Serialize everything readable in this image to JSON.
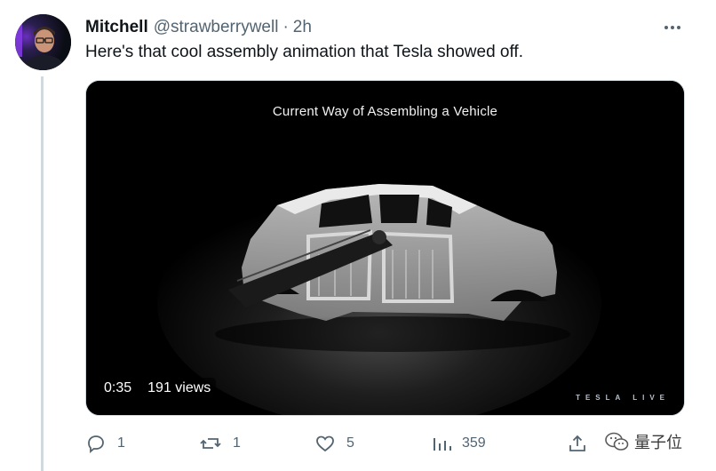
{
  "author": {
    "name": "Mitchell",
    "handle": "@strawberrywell",
    "separator": "·",
    "time": "2h"
  },
  "tweet": {
    "text": "Here's that cool assembly animation that Tesla showed off."
  },
  "media": {
    "title": "Current Way of Assembling a Vehicle",
    "duration": "0:35",
    "views": "191 views",
    "watermark": "TESLA LIVE"
  },
  "actions": {
    "replies": "1",
    "reposts": "1",
    "likes": "5",
    "views": "359"
  },
  "overlay_logo": {
    "text": "量子位"
  },
  "colors": {
    "text_primary": "#0f1419",
    "text_secondary": "#536471",
    "thread_line": "#cfd9de",
    "video_bg": "#000000"
  },
  "icons": [
    "more-icon",
    "reply-icon",
    "repost-icon",
    "like-icon",
    "views-icon",
    "share-icon",
    "wechat-logo-icon"
  ]
}
